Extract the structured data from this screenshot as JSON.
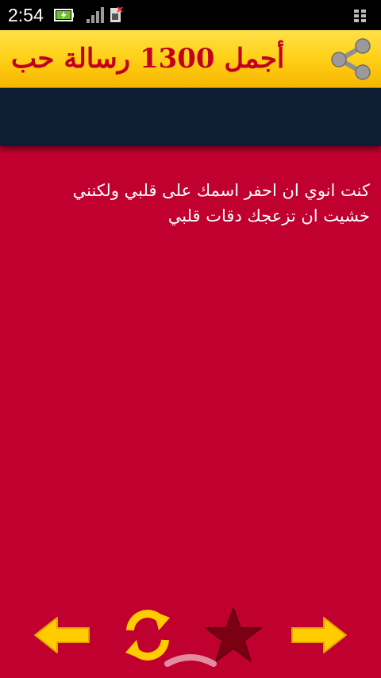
{
  "status_bar": {
    "time": "2:54",
    "icons": [
      "battery-charging-icon",
      "signal-bars-icon",
      "sim-no-service-icon",
      "menu-grid-icon"
    ]
  },
  "header": {
    "title": "أجمل 1300 رسالة حب",
    "share_icon": "share-icon"
  },
  "message": {
    "text": "كنت انوي ان احفر اسمك على قلبي ولكنني خشيت ان تزعجك دقات قلبي"
  },
  "toolbar": {
    "buttons": [
      "arrow-left-icon",
      "refresh-icon",
      "star-icon",
      "arrow-right-icon"
    ]
  },
  "colors": {
    "background": "#c0002f",
    "header_yellow": "#ffd21a",
    "title_red": "#c2001f",
    "band_navy": "#0e1e32",
    "button_yellow": "#ffcc00",
    "star_dark_red": "#7a0012"
  }
}
